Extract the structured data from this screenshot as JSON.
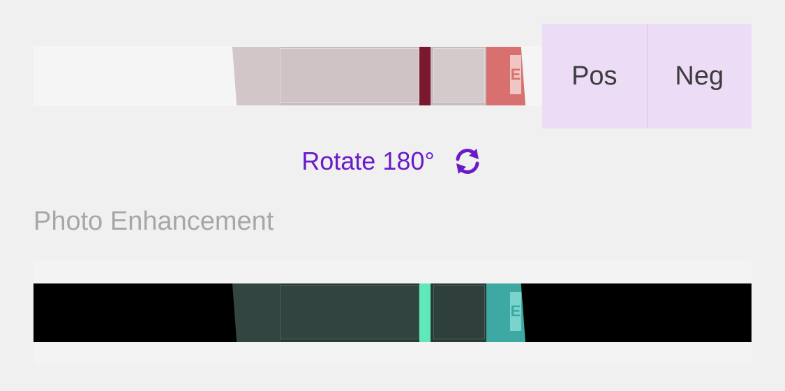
{
  "result_buttons": {
    "positive_label": "Pos",
    "negative_label": "Neg"
  },
  "rotate": {
    "label": "Rotate 180°",
    "icon": "rotate-icon"
  },
  "enhancement": {
    "heading": "Photo Enhancement"
  },
  "strip": {
    "tip_letter": "E"
  },
  "colors": {
    "accent": "#6a1bc9",
    "result_button_bg": "#ecdcf5",
    "heading_text": "#a7a7a7",
    "test_line": "#7a1830",
    "enhanced_test_line": "#5fe8b8"
  }
}
